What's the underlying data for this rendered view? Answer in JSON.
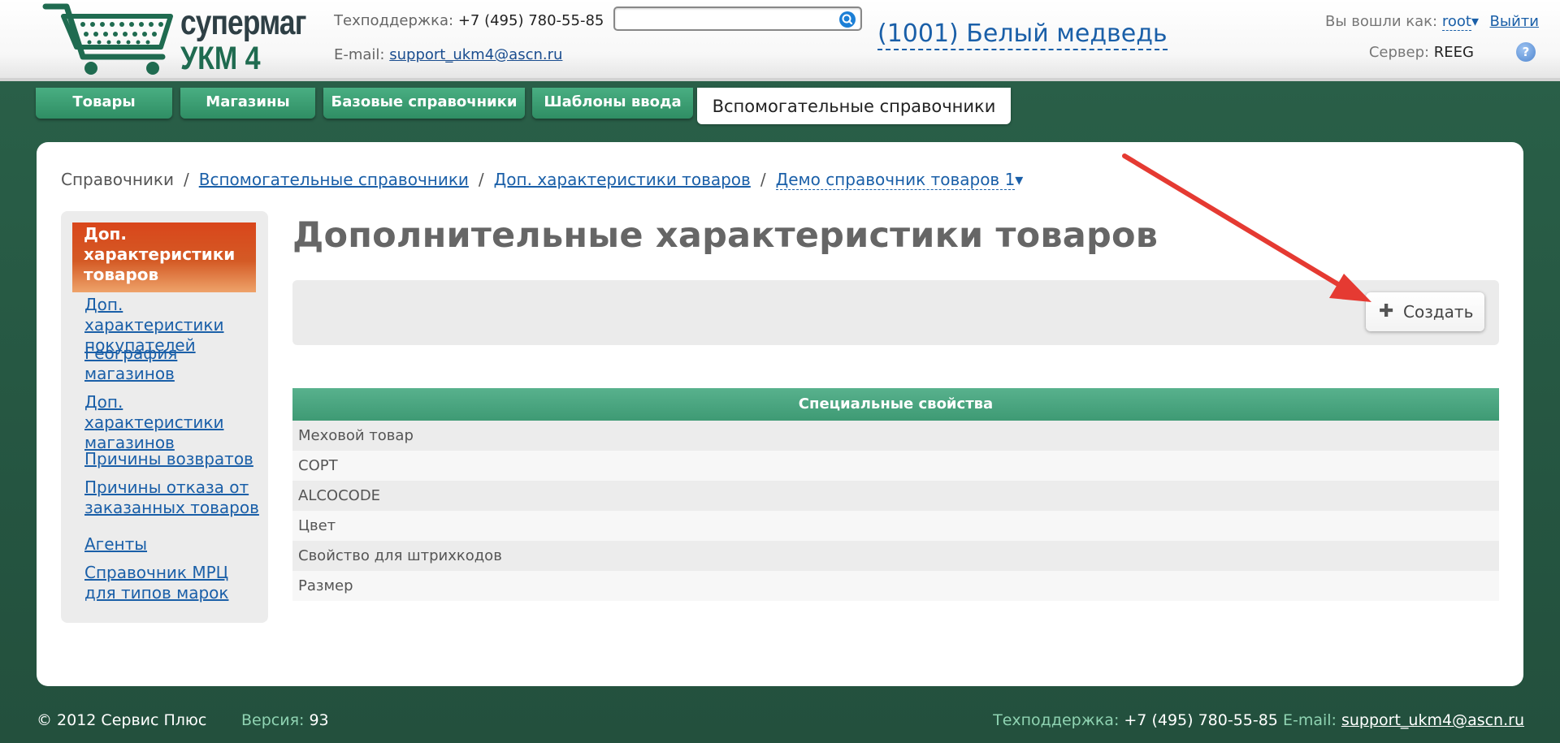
{
  "header": {
    "logo_line1": "супермаг",
    "logo_line2": "УКМ 4",
    "support_label": "Техподдержка:",
    "support_phone": "+7 (495) 780-55-85",
    "email_label": "E-mail:",
    "email": "support_ukm4@ascn.ru",
    "search_value": "",
    "store": "(1001) Белый медведь",
    "logged_as_label": "Вы вошли как:",
    "user": "root",
    "user_caret": "▾",
    "logout": "Выйти",
    "server_label": "Сервер:",
    "server": "REEG",
    "help_glyph": "?"
  },
  "tabs": [
    {
      "label": "Товары"
    },
    {
      "label": "Магазины"
    },
    {
      "label": "Базовые справочники"
    },
    {
      "label": "Шаблоны ввода"
    },
    {
      "label": "Вспомогательные справочники"
    }
  ],
  "breadcrumb": {
    "root": "Справочники",
    "sep": "/",
    "level1": "Вспомогательные справочники",
    "level2": "Доп. характеристики товаров",
    "level3": "Демо справочник товаров 1",
    "caret": "▾"
  },
  "sidebar": {
    "active": "Доп. характеристики товаров",
    "items": [
      {
        "label": "Доп. характеристики покупателей"
      },
      {
        "label": "География магазинов"
      },
      {
        "label": "Доп. характеристики магазинов"
      },
      {
        "label": "Причины возвратов"
      },
      {
        "label": "Причины отказа от заказанных товаров"
      },
      {
        "label": "Агенты"
      },
      {
        "label": "Справочник МРЦ для типов марок"
      }
    ]
  },
  "main": {
    "title": "Дополнительные характеристики товаров",
    "create_label": "Создать",
    "create_icon": "plus-icon",
    "table_header": "Специальные свойства",
    "rows": [
      "Меховой товар",
      "СОРТ",
      "ALCOCODE",
      "Цвет",
      "Свойство для штрихкодов",
      "Размер"
    ]
  },
  "footer": {
    "copyright": "© 2012 Сервис Плюс",
    "version_label": "Версия:",
    "version": "93",
    "support_label": "Техподдержка:",
    "support_phone": "+7 (495) 780-55-85",
    "email_label": "E-mail:",
    "email": "support_ukm4@ascn.ru"
  },
  "colors": {
    "background": "#265a45",
    "tab_green": "#3a9a6e",
    "active_sidebar": "#d9461b",
    "link": "#1a5fa8",
    "annotation_arrow": "#e53a32"
  }
}
